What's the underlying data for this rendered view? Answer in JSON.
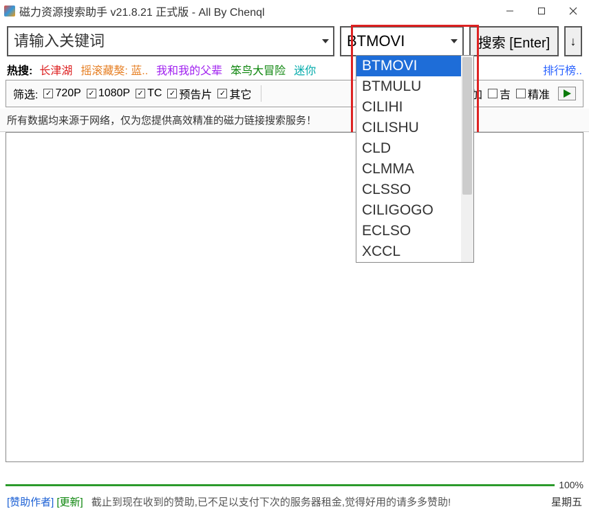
{
  "title": "磁力资源搜索助手 v21.8.21 正式版 - All By Chenql",
  "search": {
    "placeholder": "请输入关键词",
    "selected_source": "BTMOVI",
    "search_btn": "搜索 [Enter]",
    "sort_icon": "↓"
  },
  "hot": {
    "label": "热搜:",
    "items": [
      {
        "text": "长津湖",
        "cls": "hot-item-red"
      },
      {
        "text": "摇滚藏獒: 蓝..",
        "cls": "hot-item-orange"
      },
      {
        "text": "我和我的父辈",
        "cls": "hot-item-purple"
      },
      {
        "text": "笨鸟大冒险",
        "cls": "hot-item-green"
      },
      {
        "text": "迷你",
        "cls": "hot-item-cyan"
      }
    ],
    "rank": "排行榜.."
  },
  "filter": {
    "label": "筛选:",
    "opts": [
      {
        "label": "720P",
        "checked": true
      },
      {
        "label": "1080P",
        "checked": true
      },
      {
        "label": "TC",
        "checked": true
      },
      {
        "label": "预告片",
        "checked": true
      },
      {
        "label": "其它",
        "checked": true
      }
    ],
    "right": [
      {
        "label": "加",
        "checked": false
      },
      {
        "label": "吉",
        "checked": false
      },
      {
        "label": "精准",
        "checked": false
      }
    ]
  },
  "info": "所有数据均来源于网络，仅为您提供高效精准的磁力链接搜索服务！",
  "dropdown": {
    "items": [
      "BTMOVI",
      "BTMULU",
      "CILIHI",
      "CILISHU",
      "CLD",
      "CLMMA",
      "CLSSO",
      "CILIGOGO",
      "ECLSO",
      "XCCL"
    ],
    "selected_index": 0
  },
  "progress": {
    "pct": "100%"
  },
  "status": {
    "sponsor": "[赞助作者]",
    "update": "[更新]",
    "msg": "截止到现在收到的赞助,已不足以支付下次的服务器租金,觉得好用的请多多赞助!",
    "day": "星期五"
  }
}
